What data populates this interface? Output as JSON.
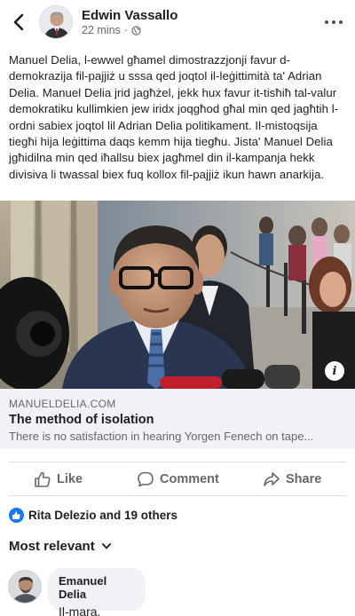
{
  "post": {
    "author": "Edwin Vassallo",
    "time": "22 mins",
    "separator": "·",
    "privacy_icon": "globe-icon",
    "text": "Manuel Delia, l-ewwel għamel dimostrazzjonji favur d-demokrazija fil-pajjiż u sssa qed joqtol il-leġittimità ta' Adrian Delia. Manuel Delia jrid jagħżel, jekk hux favur it-tisħiħ tal-valur demokratiku kullimkien jew iridx joqgħod għal min qed jagħtih l-ordni sabiex joqtol lil Adrian Delia politikament. Il-mistoqsija tiegħi hija leġittima daqs kemm hija tiegħu. Jista' Manuel Delia jgħidilna min qed iħallsu biex jagħmel din il-kampanja hekk divisiva li twassal biex fuq kollox fil-pajjiż ikun hawn anarkija."
  },
  "link": {
    "domain": "MANUELDELIA.COM",
    "title": "The method of isolation",
    "description": "There is no satisfaction in hearing Yorgen Fenech on tape..."
  },
  "actions": {
    "like": "Like",
    "comment": "Comment",
    "share": "Share"
  },
  "reactions": {
    "summary": "Rita Delezio and 19 others"
  },
  "comments": {
    "sort_label": "Most relevant",
    "items": [
      {
        "author": "Emanuel Delia",
        "text": "Il-mara."
      }
    ]
  },
  "colors": {
    "accent": "#1877f2",
    "secondary_text": "#65676b",
    "preview_bg": "#f0f2f5"
  }
}
